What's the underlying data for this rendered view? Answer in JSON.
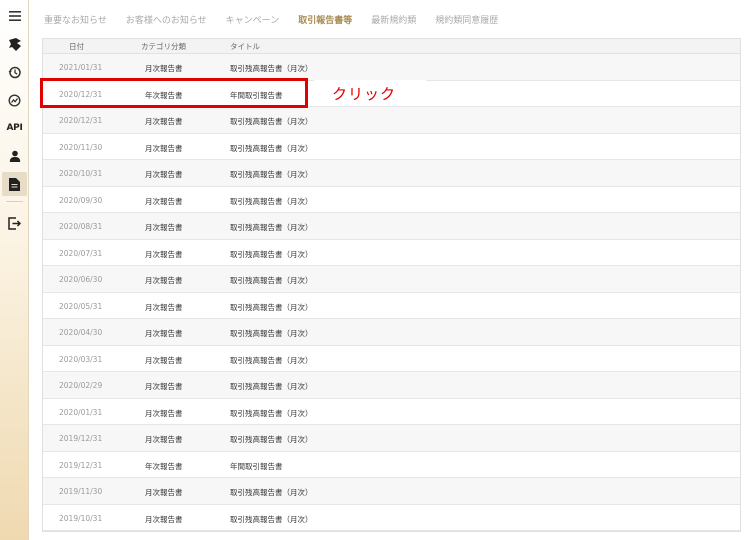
{
  "sidebar": {
    "items": [
      {
        "icon": "menu-icon"
      },
      {
        "icon": "logo-icon"
      },
      {
        "icon": "history-icon"
      },
      {
        "icon": "chart-icon"
      },
      {
        "icon": "api-icon",
        "label": "API"
      },
      {
        "icon": "user-icon"
      },
      {
        "icon": "document-icon",
        "active": true
      },
      {
        "icon": "logout-icon"
      }
    ]
  },
  "tabs": [
    {
      "label": "重要なお知らせ"
    },
    {
      "label": "お客様へのお知らせ"
    },
    {
      "label": "キャンペーン"
    },
    {
      "label": "取引報告書等",
      "active": true
    },
    {
      "label": "最新規約類"
    },
    {
      "label": "規約類同意履歴"
    }
  ],
  "table": {
    "headers": {
      "date": "日付",
      "category": "カテゴリ分類",
      "title": "タイトル"
    },
    "rows": [
      {
        "date": "2021/01/31",
        "category": "月次報告書",
        "title": "取引残高報告書（月次）"
      },
      {
        "date": "2020/12/31",
        "category": "年次報告書",
        "title": "年間取引報告書"
      },
      {
        "date": "2020/12/31",
        "category": "月次報告書",
        "title": "取引残高報告書（月次）"
      },
      {
        "date": "2020/11/30",
        "category": "月次報告書",
        "title": "取引残高報告書（月次）"
      },
      {
        "date": "2020/10/31",
        "category": "月次報告書",
        "title": "取引残高報告書（月次）"
      },
      {
        "date": "2020/09/30",
        "category": "月次報告書",
        "title": "取引残高報告書（月次）"
      },
      {
        "date": "2020/08/31",
        "category": "月次報告書",
        "title": "取引残高報告書（月次）"
      },
      {
        "date": "2020/07/31",
        "category": "月次報告書",
        "title": "取引残高報告書（月次）"
      },
      {
        "date": "2020/06/30",
        "category": "月次報告書",
        "title": "取引残高報告書（月次）"
      },
      {
        "date": "2020/05/31",
        "category": "月次報告書",
        "title": "取引残高報告書（月次）"
      },
      {
        "date": "2020/04/30",
        "category": "月次報告書",
        "title": "取引残高報告書（月次）"
      },
      {
        "date": "2020/03/31",
        "category": "月次報告書",
        "title": "取引残高報告書（月次）"
      },
      {
        "date": "2020/02/29",
        "category": "月次報告書",
        "title": "取引残高報告書（月次）"
      },
      {
        "date": "2020/01/31",
        "category": "月次報告書",
        "title": "取引残高報告書（月次）"
      },
      {
        "date": "2019/12/31",
        "category": "月次報告書",
        "title": "取引残高報告書（月次）"
      },
      {
        "date": "2019/12/31",
        "category": "年次報告書",
        "title": "年間取引報告書"
      },
      {
        "date": "2019/11/30",
        "category": "月次報告書",
        "title": "取引残高報告書（月次）"
      },
      {
        "date": "2019/10/31",
        "category": "月次報告書",
        "title": "取引残高報告書（月次）"
      }
    ]
  },
  "annotation": {
    "label": "クリック",
    "color": "#e00000"
  },
  "colors": {
    "accent": "#a88b52",
    "highlight": "#e00000"
  }
}
